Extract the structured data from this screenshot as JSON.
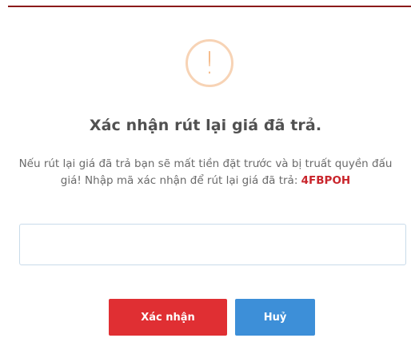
{
  "dialog": {
    "icon_name": "exclamation-circle-icon",
    "icon_glyph": "!",
    "title": "Xác nhận rút lại giá đã trả.",
    "message_prefix": "Nếu rút lại giá đã trả bạn sẽ mất tiền đặt trước và bị truất quyền đấu giá! Nhập mã xác nhận để rút lại giá đã trả: ",
    "confirmation_code": "4FBPOH",
    "input_value": "",
    "confirm_label": "Xác nhận",
    "cancel_label": "Huỷ"
  },
  "colors": {
    "top_border": "#8b1a1a",
    "icon": "#f5b682",
    "code": "#c9252c",
    "confirm_button": "#e02f33",
    "cancel_button": "#3d8fd8"
  }
}
